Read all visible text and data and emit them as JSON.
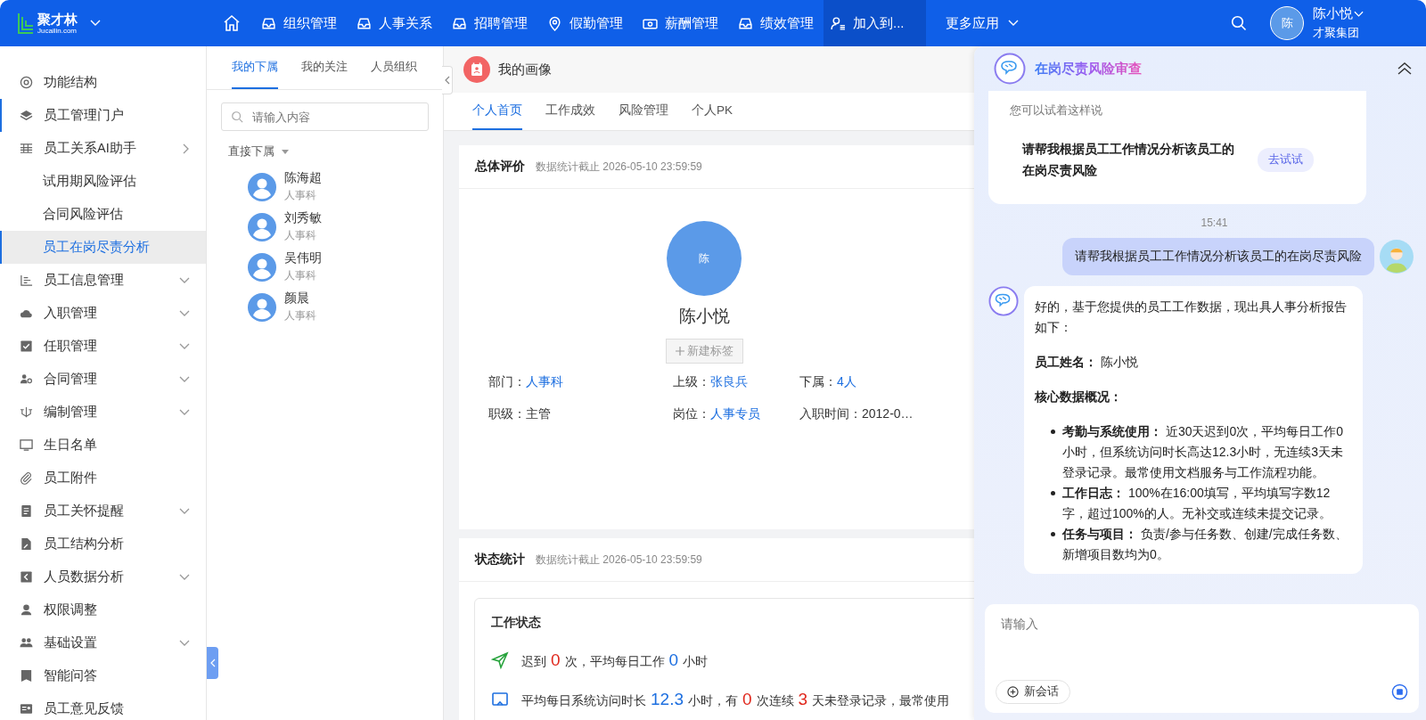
{
  "top_bar": {
    "brand": "聚才林",
    "brand_domain": "Jucailin.com",
    "nav": [
      {
        "label": "组织管理",
        "selected": false
      },
      {
        "label": "人事关系",
        "selected": false
      },
      {
        "label": "招聘管理",
        "selected": false
      },
      {
        "label": "假勤管理",
        "selected": false
      },
      {
        "label": "薪酬管理",
        "selected": false
      },
      {
        "label": "绩效管理",
        "selected": false
      },
      {
        "label": "加入到...",
        "selected": true
      }
    ],
    "more": "更多应用",
    "user": {
      "avatar": "陈",
      "name": "陈小悦",
      "company": "才聚集团"
    }
  },
  "sidebar": {
    "items": [
      {
        "label": "功能结构",
        "active": false,
        "selected": false
      },
      {
        "label": "员工管理门户",
        "active": true,
        "selected": false
      },
      {
        "label": "员工关系AI助手",
        "expanded": true,
        "active": false,
        "selected": false,
        "children": [
          {
            "label": "试用期风险评估",
            "selected": false
          },
          {
            "label": "合同风险评估",
            "selected": false
          },
          {
            "label": "员工在岗尽责分析",
            "selected": true
          }
        ]
      },
      {
        "label": "员工信息管理",
        "expanded": false,
        "active": false,
        "selected": false
      },
      {
        "label": "入职管理",
        "expanded": false,
        "active": false,
        "selected": false
      },
      {
        "label": "任职管理",
        "expanded": false,
        "active": false,
        "selected": false
      },
      {
        "label": "合同管理",
        "expanded": false,
        "active": false,
        "selected": false
      },
      {
        "label": "编制管理",
        "expanded": false,
        "active": false,
        "selected": false
      },
      {
        "label": "生日名单",
        "active": false,
        "selected": false
      },
      {
        "label": "员工附件",
        "active": false,
        "selected": false
      },
      {
        "label": "员工关怀提醒",
        "expanded": false,
        "active": false,
        "selected": false
      },
      {
        "label": "员工结构分析",
        "active": false,
        "selected": false
      },
      {
        "label": "人员数据分析",
        "expanded": false,
        "active": false,
        "selected": false
      },
      {
        "label": "权限调整",
        "active": false,
        "selected": false
      },
      {
        "label": "基础设置",
        "expanded": false,
        "active": false,
        "selected": false
      },
      {
        "label": "智能问答",
        "active": false,
        "selected": false
      },
      {
        "label": "员工意见反馈",
        "active": false,
        "selected": false
      }
    ]
  },
  "people_panel": {
    "tabs": [
      {
        "label": "我的下属",
        "selected": true
      },
      {
        "label": "我的关注",
        "selected": false
      },
      {
        "label": "人员组织",
        "selected": false
      }
    ],
    "search": {
      "placeholder": "请输入内容"
    },
    "filter": "直接下属",
    "people": [
      {
        "name": "陈海超",
        "dept": "人事科"
      },
      {
        "name": "刘秀敏",
        "dept": "人事科"
      },
      {
        "name": "吴伟明",
        "dept": "人事科"
      },
      {
        "name": "颜晨",
        "dept": "人事科"
      }
    ]
  },
  "main": {
    "title": "我的画像",
    "tabs": [
      {
        "label": "个人首页",
        "selected": true
      },
      {
        "label": "工作成效",
        "selected": false
      },
      {
        "label": "风险管理",
        "selected": false
      },
      {
        "label": "个人PK",
        "selected": false
      }
    ],
    "overview": {
      "title": "总体评价",
      "note": "数据统计截止 2026-05-10 23:59:59",
      "avatar": "陈",
      "name": "陈小悦",
      "tag_button": "新建标签",
      "fields": [
        {
          "label": "部门：",
          "value": "人事科",
          "link": true
        },
        {
          "label": "上级：",
          "value": "张良兵",
          "link": true
        },
        {
          "label": "下属：",
          "value": "4人",
          "link": true
        },
        {
          "label": "职级：",
          "value": "主管",
          "link": false
        },
        {
          "label": "岗位：",
          "value": "人事专员",
          "link": true
        },
        {
          "label": "入职时间：",
          "value": "2012-0…",
          "link": false
        }
      ]
    },
    "stats": {
      "title": "状态统计",
      "note": "数据统计截止 2026-05-10 23:59:59",
      "box_title": "工作状态",
      "lines": [
        {
          "parts": [
            {
              "kind": "text",
              "text": "迟到"
            },
            {
              "kind": "alert",
              "text": "0"
            },
            {
              "kind": "text",
              "text": "次，平均每日工作"
            },
            {
              "kind": "metric",
              "text": "0"
            },
            {
              "kind": "text",
              "text": "小时"
            }
          ]
        },
        {
          "parts": [
            {
              "kind": "text",
              "text": "平均每日系统访问时长"
            },
            {
              "kind": "metric",
              "text": "12.3"
            },
            {
              "kind": "text",
              "text": "小时，有"
            },
            {
              "kind": "alert",
              "text": "0"
            },
            {
              "kind": "text",
              "text": "次连续"
            },
            {
              "kind": "alert",
              "text": "3"
            },
            {
              "kind": "text",
              "text": "天未登录记录，最常使用"
            }
          ]
        }
      ]
    }
  },
  "chat": {
    "title": "在岗尽责风险审查",
    "prompt_card": {
      "hint": "您可以试着这样说",
      "suggestion": "请帮我根据员工工作情况分析该员工的在岗尽责风险",
      "try_button": "去试试"
    },
    "time": "15:41",
    "user_message": "请帮我根据员工工作情况分析该员工的在岗尽责风险",
    "reply": {
      "intro": "好的，基于您提供的员工工作数据，现出具人事分析报告如下：",
      "name_line": "**员工姓名：** 陈小悦",
      "section": "核心数据概况：",
      "bullets": [
        "**考勤与系统使用：** 近30天迟到0次，平均每日工作0小时，但系统访问时长高达12.3小时，无连续3天未登录记录。最常使用文档服务与工作流程功能。",
        "**工作日志：** 100%在16:00填写，平均填写字数12字，超过100%的人。无补交或连续未提交记录。",
        "**任务与项目：** 负责/参与任务数、创建/完成任务数、新增项目数均为0。"
      ]
    },
    "input": {
      "placeholder": "请输入"
    },
    "new_chat_button": "新会话"
  }
}
